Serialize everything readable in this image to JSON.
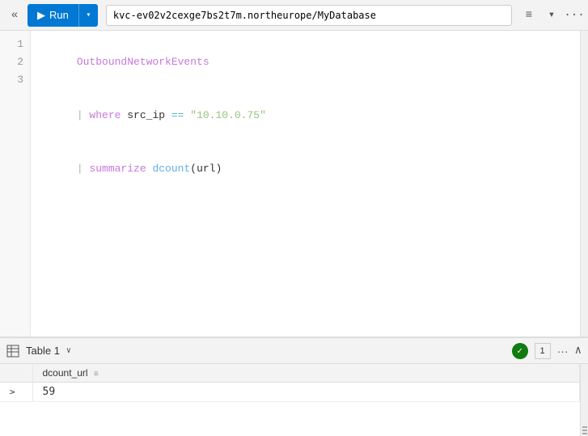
{
  "toolbar": {
    "collapse_icon": "«",
    "run_label": "Run",
    "run_icon": "▶",
    "dropdown_arrow": "▾",
    "connection": "kvc-ev02v2cexge7bs2t7m.northeurope/MyDatabase",
    "filter_icon": "≡",
    "caret_icon": "▾",
    "more_icon": "···"
  },
  "editor": {
    "lines": [
      {
        "number": "1",
        "tokens": [
          {
            "text": "OutboundNetworkEvents",
            "class": "kw-table"
          }
        ]
      },
      {
        "number": "2",
        "tokens": [
          {
            "text": "| ",
            "class": "kw-pipe"
          },
          {
            "text": "where",
            "class": "kw-where"
          },
          {
            "text": " src_ip ",
            "class": "code-plain"
          },
          {
            "text": "==",
            "class": "kw-operator"
          },
          {
            "text": " \"10.10.0.75\"",
            "class": "kw-string"
          }
        ]
      },
      {
        "number": "3",
        "tokens": [
          {
            "text": "| ",
            "class": "kw-pipe"
          },
          {
            "text": "summarize",
            "class": "kw-summarize"
          },
          {
            "text": " ",
            "class": "code-plain"
          },
          {
            "text": "dcount",
            "class": "kw-function"
          },
          {
            "text": "(url)",
            "class": "code-plain"
          }
        ]
      }
    ]
  },
  "results": {
    "table_icon": "⊞",
    "table_label": "Table 1",
    "dropdown_arrow": "∨",
    "status_check": "✓",
    "page_number": "1",
    "more_label": "···",
    "collapse_label": "∧",
    "columns": [
      {
        "name": "dcount_url",
        "menu": "≡"
      }
    ],
    "rows": [
      {
        "expand": ">",
        "values": [
          "59"
        ]
      }
    ]
  }
}
